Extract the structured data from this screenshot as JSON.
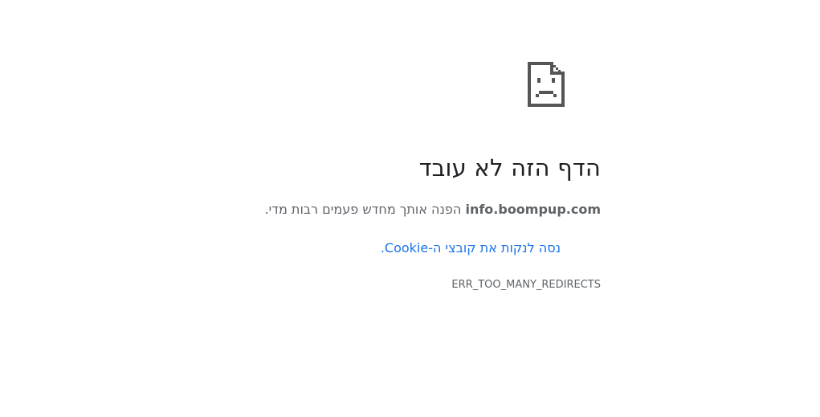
{
  "icon": {
    "name": "sad-page-icon",
    "color": "#555555"
  },
  "error": {
    "title": "הדף הזה לא עובד",
    "domain": "info.boompup.com",
    "summary_text": " הפנה אותך מחדש פעמים רבות מדי.",
    "suggestion_link": "נסה לנקות את קובצי ה-Cookie.",
    "code": "ERR_TOO_MANY_REDIRECTS"
  },
  "colors": {
    "title": "#202124",
    "body_text": "#5f6368",
    "link": "#1a73e8"
  }
}
